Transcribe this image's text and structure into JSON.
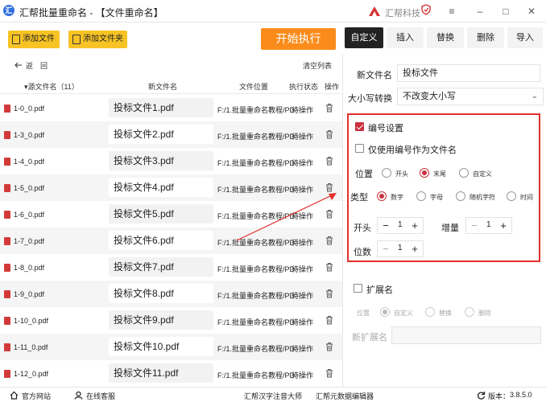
{
  "window": {
    "title": "汇帮批量重命名 - 【文件重命名】",
    "brand": "汇帮科技",
    "logo_letter": "汇"
  },
  "toolbar": {
    "add_file": "添加文件",
    "add_folder": "添加文件夹",
    "start": "开始执行",
    "tabs": [
      "自定义",
      "插入",
      "替换",
      "删除",
      "导入"
    ]
  },
  "list": {
    "back": "返",
    "refresh": "回",
    "clear": "清空列表",
    "headers": {
      "source": "源文件名（11）",
      "new_name": "新文件名",
      "location": "文件位置",
      "status": "执行状态",
      "action": "操作"
    },
    "rows": [
      {
        "source": "1-0_0.pdf",
        "new_name": "投标文件1.pdf",
        "location": "F:/1.批量重命名教程/PD",
        "status": "待操作"
      },
      {
        "source": "1-3_0.pdf",
        "new_name": "投标文件2.pdf",
        "location": "F:/1.批量重命名教程/PD",
        "status": "待操作"
      },
      {
        "source": "1-4_0.pdf",
        "new_name": "投标文件3.pdf",
        "location": "F:/1.批量重命名教程/PD",
        "status": "待操作"
      },
      {
        "source": "1-5_0.pdf",
        "new_name": "投标文件4.pdf",
        "location": "F:/1.批量重命名教程/PD",
        "status": "待操作"
      },
      {
        "source": "1-6_0.pdf",
        "new_name": "投标文件5.pdf",
        "location": "F:/1.批量重命名教程/PD",
        "status": "待操作"
      },
      {
        "source": "1-7_0.pdf",
        "new_name": "投标文件6.pdf",
        "location": "F:/1.批量重命名教程/PD",
        "status": "待操作"
      },
      {
        "source": "1-8_0.pdf",
        "new_name": "投标文件7.pdf",
        "location": "F:/1.批量重命名教程/PD",
        "status": "待操作"
      },
      {
        "source": "1-9_0.pdf",
        "new_name": "投标文件8.pdf",
        "location": "F:/1.批量重命名教程/PD",
        "status": "待操作"
      },
      {
        "source": "1-10_0.pdf",
        "new_name": "投标文件9.pdf",
        "location": "F:/1.批量重命名教程/PD",
        "status": "待操作"
      },
      {
        "source": "1-11_0.pdf",
        "new_name": "投标文件10.pdf",
        "location": "F:/1.批量重命名教程/PD",
        "status": "待操作"
      },
      {
        "source": "1-12_0.pdf",
        "new_name": "投标文件11.pdf",
        "location": "F:/1.批量重命名教程/PD",
        "status": "待操作"
      }
    ]
  },
  "settings": {
    "new_name_label": "新文件名",
    "new_name_value": "投标文件",
    "case_label": "大小写转换",
    "case_value": "不改变大小写",
    "numbering": {
      "enable_label": "编号设置",
      "enabled": true,
      "only_number_label": "仅使用编号作为文件名",
      "only_number": false,
      "position_label": "位置",
      "position_options": [
        "开头",
        "末尾",
        "自定义"
      ],
      "position_selected": "末尾",
      "type_label": "类型",
      "type_options": [
        "数字",
        "字母",
        "随机字符",
        "时间"
      ],
      "type_selected": "数字",
      "start_label": "开头",
      "start_value": "1",
      "increment_label": "增量",
      "increment_value": "1",
      "digits_label": "位数",
      "digits_value": "1"
    },
    "extension": {
      "enable_label": "扩展名",
      "enabled": false,
      "position_label": "位置",
      "options": [
        "自定义",
        "替换",
        "删除"
      ],
      "selected": "自定义",
      "new_ext_label": "新扩展名",
      "new_ext_value": ""
    }
  },
  "statusbar": {
    "website": "官方网站",
    "support": "在线客服",
    "link1": "汇帮汉字注音大师",
    "link2": "汇帮元数据编辑器",
    "version_label": "版本：",
    "version": "3.8.5.0"
  },
  "colors": {
    "accent_red": "#e2302c",
    "start_orange": "#fb8c1c",
    "button_yellow": "#f7c325",
    "check_red": "#c9313d"
  }
}
